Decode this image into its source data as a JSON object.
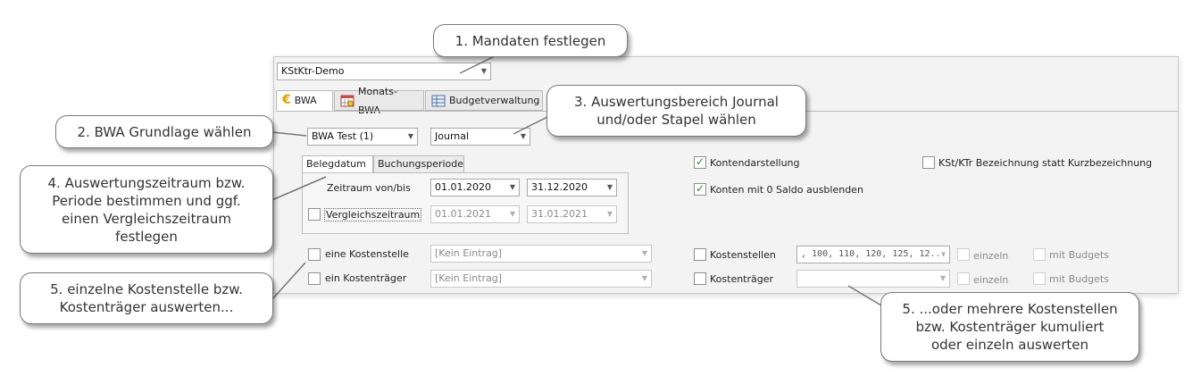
{
  "mandant_select": {
    "value": "KStKtr-Demo"
  },
  "tabs": [
    {
      "label": "BWA"
    },
    {
      "label": "Monats-BWA"
    },
    {
      "label": "Budgetverwaltung"
    }
  ],
  "bwa_select": {
    "value": "BWA Test (1)"
  },
  "journal_select": {
    "value": "Journal"
  },
  "subtabs": [
    {
      "label": "Belegdatum"
    },
    {
      "label": "Buchungsperiode"
    }
  ],
  "zeitraum": {
    "label": "Zeitraum von/bis",
    "from": "01.01.2020",
    "to": "31.12.2020"
  },
  "vergleich": {
    "label": "Vergleichszeitraum",
    "from": "01.01.2021",
    "to": "31.01.2021"
  },
  "kostenstelle": {
    "label": "eine Kostenstelle",
    "value": "[Kein Eintrag]"
  },
  "kostentraeger": {
    "label": "ein Kostenträger",
    "value": "[Kein Eintrag]"
  },
  "options": {
    "kontendarstellung": "Kontendarstellung",
    "konten_null": "Konten mit 0 Saldo ausblenden",
    "kst_bezeichnung": "KSt/KTr Bezeichnung statt Kurzbezeichnung"
  },
  "multi": {
    "kostenstellen_label": "Kostenstellen",
    "kostenstellen_value": ", 100, 110, 120, 125, 12...",
    "kostentraeger_label": "Kostenträger",
    "kostentraeger_value": "",
    "einzeln": "einzeln",
    "mit_budgets": "mit Budgets"
  },
  "callouts": {
    "c1": "1. Mandaten festlegen",
    "c2": "2. BWA Grundlage wählen",
    "c3_line1": "3. Auswertungsbereich Journal",
    "c3_line2": "und/oder Stapel wählen",
    "c4_line1": "4. Auswertungszeitraum bzw.",
    "c4_line2": "Periode bestimmen und ggf.",
    "c4_line3": "einen Vergleichszeitraum",
    "c4_line4": "festlegen",
    "c5a_line1": "5. einzelne Kostenstelle bzw.",
    "c5a_line2": "Kostenträger auswerten...",
    "c5b_line1": "5. ...oder mehrere Kostenstellen",
    "c5b_line2": "bzw. Kostenträger kumuliert",
    "c5b_line3": "oder einzeln auswerten"
  },
  "colors": {
    "accent_check": "#3a7d3a",
    "euro_icon": "#e0a100"
  }
}
